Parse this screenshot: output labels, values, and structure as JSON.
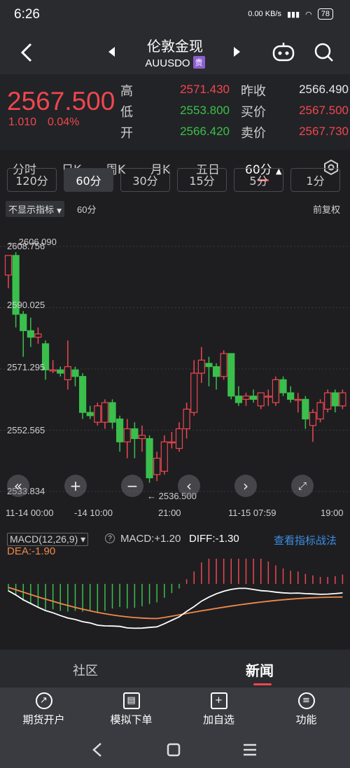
{
  "status": {
    "time": "6:26",
    "net_speed": "0.00 KB/s",
    "battery": "78"
  },
  "nav": {
    "title": "伦敦金现",
    "symbol": "AUUSDO",
    "badge": "贵"
  },
  "quote": {
    "price": "2567.500",
    "change": "1.010",
    "change_pct": "0.04%",
    "high_label": "高",
    "high": "2571.430",
    "low_label": "低",
    "low": "2553.800",
    "open_label": "开",
    "open": "2566.420",
    "prev_label": "昨收",
    "prev": "2566.490",
    "bid_label": "买价",
    "bid": "2567.500",
    "ask_label": "卖价",
    "ask": "2567.730"
  },
  "period_tabs": [
    "分时",
    "日K",
    "周K",
    "月K",
    "五日",
    "60分"
  ],
  "interval_chips": [
    "120分",
    "60分",
    "30分",
    "15分",
    "5分",
    "1分"
  ],
  "chart": {
    "indicator_select": "不显示指标",
    "period_label": "60分",
    "adjust_label": "前复权",
    "max_marker": "2606.090",
    "min_marker": "2536.500",
    "y_labels": [
      "2608.756",
      "2590.025",
      "2571.295",
      "2552.565",
      "2533.834"
    ],
    "x_labels": [
      "11-14 00:00",
      "-14 10:00",
      "21:00",
      "11-15 07:59",
      "19:00"
    ]
  },
  "chart_data": {
    "type": "candlestick",
    "ylim": [
      2533.834,
      2608.756
    ],
    "candles": [
      {
        "o": 2600,
        "c": 2606,
        "h": 2606,
        "l": 2596
      },
      {
        "o": 2606,
        "c": 2588,
        "h": 2607,
        "l": 2584
      },
      {
        "o": 2588,
        "c": 2583,
        "h": 2589,
        "l": 2575
      },
      {
        "o": 2583,
        "c": 2581,
        "h": 2587,
        "l": 2578
      },
      {
        "o": 2581,
        "c": 2582,
        "h": 2584,
        "l": 2579
      },
      {
        "o": 2579,
        "c": 2571,
        "h": 2580,
        "l": 2568
      },
      {
        "o": 2571,
        "c": 2571,
        "h": 2574,
        "l": 2570
      },
      {
        "o": 2571,
        "c": 2570,
        "h": 2572,
        "l": 2569
      },
      {
        "o": 2568,
        "c": 2572,
        "h": 2580,
        "l": 2565
      },
      {
        "o": 2571,
        "c": 2569,
        "h": 2572,
        "l": 2566
      },
      {
        "o": 2569,
        "c": 2558,
        "h": 2570,
        "l": 2556
      },
      {
        "o": 2558,
        "c": 2557,
        "h": 2560,
        "l": 2556
      },
      {
        "o": 2555,
        "c": 2560,
        "h": 2561,
        "l": 2554
      },
      {
        "o": 2555,
        "c": 2561,
        "h": 2562,
        "l": 2553
      },
      {
        "o": 2561,
        "c": 2555,
        "h": 2562,
        "l": 2553
      },
      {
        "o": 2556,
        "c": 2549,
        "h": 2557,
        "l": 2546
      },
      {
        "o": 2549,
        "c": 2553,
        "h": 2556,
        "l": 2544
      },
      {
        "o": 2553,
        "c": 2550,
        "h": 2555,
        "l": 2544
      },
      {
        "o": 2550,
        "c": 2551,
        "h": 2554,
        "l": 2546
      },
      {
        "o": 2550,
        "c": 2538,
        "h": 2551,
        "l": 2536.5
      },
      {
        "o": 2539,
        "c": 2544,
        "h": 2546,
        "l": 2537
      },
      {
        "o": 2540,
        "c": 2549,
        "h": 2551,
        "l": 2539
      },
      {
        "o": 2549,
        "c": 2549,
        "h": 2552,
        "l": 2547
      },
      {
        "o": 2547,
        "c": 2553,
        "h": 2555,
        "l": 2546
      },
      {
        "o": 2553,
        "c": 2559,
        "h": 2561,
        "l": 2550
      },
      {
        "o": 2558,
        "c": 2570,
        "h": 2574,
        "l": 2557
      },
      {
        "o": 2570,
        "c": 2574,
        "h": 2578,
        "l": 2567
      },
      {
        "o": 2573,
        "c": 2572,
        "h": 2575,
        "l": 2566
      },
      {
        "o": 2572,
        "c": 2569,
        "h": 2573,
        "l": 2565
      },
      {
        "o": 2569,
        "c": 2576,
        "h": 2577,
        "l": 2568
      },
      {
        "o": 2576,
        "c": 2563,
        "h": 2576,
        "l": 2562
      },
      {
        "o": 2563,
        "c": 2561,
        "h": 2566,
        "l": 2560
      },
      {
        "o": 2562,
        "c": 2563,
        "h": 2564,
        "l": 2560
      },
      {
        "o": 2563,
        "c": 2562,
        "h": 2565,
        "l": 2561
      },
      {
        "o": 2560,
        "c": 2564,
        "h": 2564,
        "l": 2559
      },
      {
        "o": 2563,
        "c": 2563,
        "h": 2565,
        "l": 2560
      },
      {
        "o": 2561,
        "c": 2568,
        "h": 2569,
        "l": 2560
      },
      {
        "o": 2568,
        "c": 2564,
        "h": 2569,
        "l": 2563
      },
      {
        "o": 2564,
        "c": 2562,
        "h": 2566,
        "l": 2561
      },
      {
        "o": 2562,
        "c": 2562,
        "h": 2564,
        "l": 2558
      },
      {
        "o": 2562,
        "c": 2556,
        "h": 2563,
        "l": 2553
      },
      {
        "o": 2554,
        "c": 2558,
        "h": 2559,
        "l": 2549
      },
      {
        "o": 2556,
        "c": 2561,
        "h": 2562,
        "l": 2555
      },
      {
        "o": 2559,
        "c": 2564,
        "h": 2565,
        "l": 2558
      },
      {
        "o": 2564,
        "c": 2560,
        "h": 2565,
        "l": 2558
      },
      {
        "o": 2560,
        "c": 2564,
        "h": 2565,
        "l": 2559
      }
    ],
    "macd": {
      "label": "MACD(12,26,9)",
      "macd_text": "MACD:+1.20",
      "diff_text": "DIFF:-1.30",
      "dea_text": "DEA:-1.90",
      "link": "查看指标战法",
      "hist": [
        -1.0,
        -1.5,
        -2.2,
        -2.6,
        -3.0,
        -3.3,
        -3.3,
        -3.5,
        -3.6,
        -3.5,
        -3.6,
        -3.5,
        -3.7,
        -3.5,
        -3.2,
        -3.0,
        -3.2,
        -3.1,
        -2.9,
        -2.6,
        -2.4,
        -1.8,
        -1.2,
        -0.6,
        0.6,
        1.6,
        2.8,
        3.6,
        4.2,
        4.6,
        4.8,
        4.8,
        4.5,
        3.9,
        3.3,
        2.9,
        2.4,
        2.0,
        1.7,
        1.6,
        1.3,
        1.1,
        0.9,
        0.9,
        1.0,
        1.2
      ]
    }
  },
  "bottom_tabs": {
    "community": "社区",
    "news": "新闻"
  },
  "toolbar": [
    "期货开户",
    "模拟下单",
    "加自选",
    "功能"
  ]
}
